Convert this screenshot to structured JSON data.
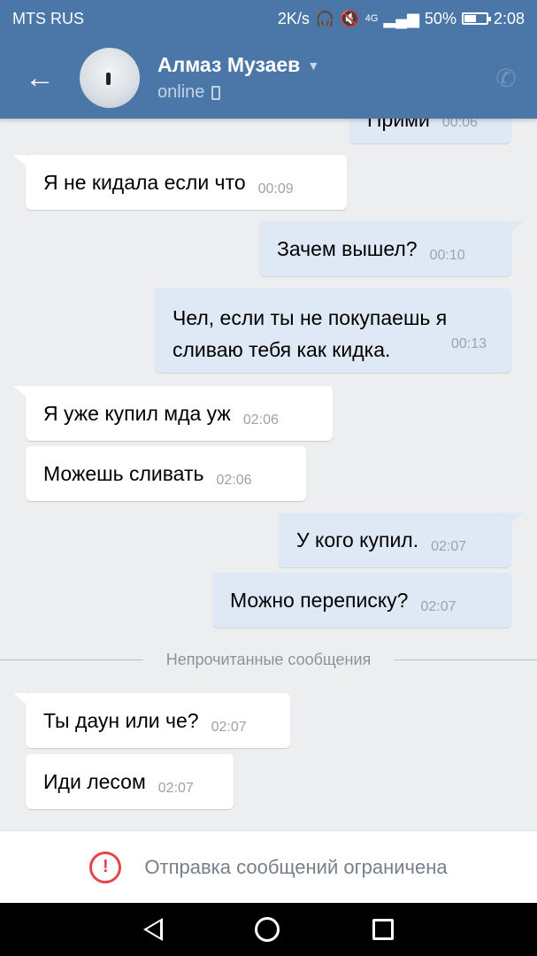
{
  "status_bar": {
    "carrier": "MTS RUS",
    "speed": "2K/s",
    "network": "4G",
    "battery": "50%",
    "time": "2:08"
  },
  "header": {
    "name": "Алмаз Музаев",
    "status": "online"
  },
  "messages": [
    {
      "dir": "out",
      "text": "Прими",
      "time": "00:06"
    },
    {
      "dir": "in",
      "text": "Я не кидала если что",
      "time": "00:09"
    },
    {
      "dir": "out",
      "text": "Зачем вышел?",
      "time": "00:10"
    },
    {
      "dir": "out",
      "text": "Чел, если ты не покупаешь я сливаю тебя как кидка.",
      "time": "00:13"
    },
    {
      "dir": "in",
      "text": "Я уже купил мда уж",
      "time": "02:06"
    },
    {
      "dir": "in",
      "text": "Можешь сливать",
      "time": "02:06"
    },
    {
      "dir": "out",
      "text": "У кого купил.",
      "time": "02:07"
    },
    {
      "dir": "out",
      "text": "Можно переписку?",
      "time": "02:07"
    },
    {
      "dir": "in",
      "text": "Ты даун или че?",
      "time": "02:07"
    },
    {
      "dir": "in",
      "text": "Иди лесом",
      "time": "02:07"
    }
  ],
  "unread_divider": "Непрочитанные сообщения",
  "restriction": {
    "icon": "!",
    "text": "Отправка сообщений ограничена"
  },
  "colors": {
    "header": "#4a76a8",
    "incoming": "#ffffff",
    "outgoing": "#dfe9f6",
    "background": "#edeef0",
    "warning": "#e64646"
  }
}
